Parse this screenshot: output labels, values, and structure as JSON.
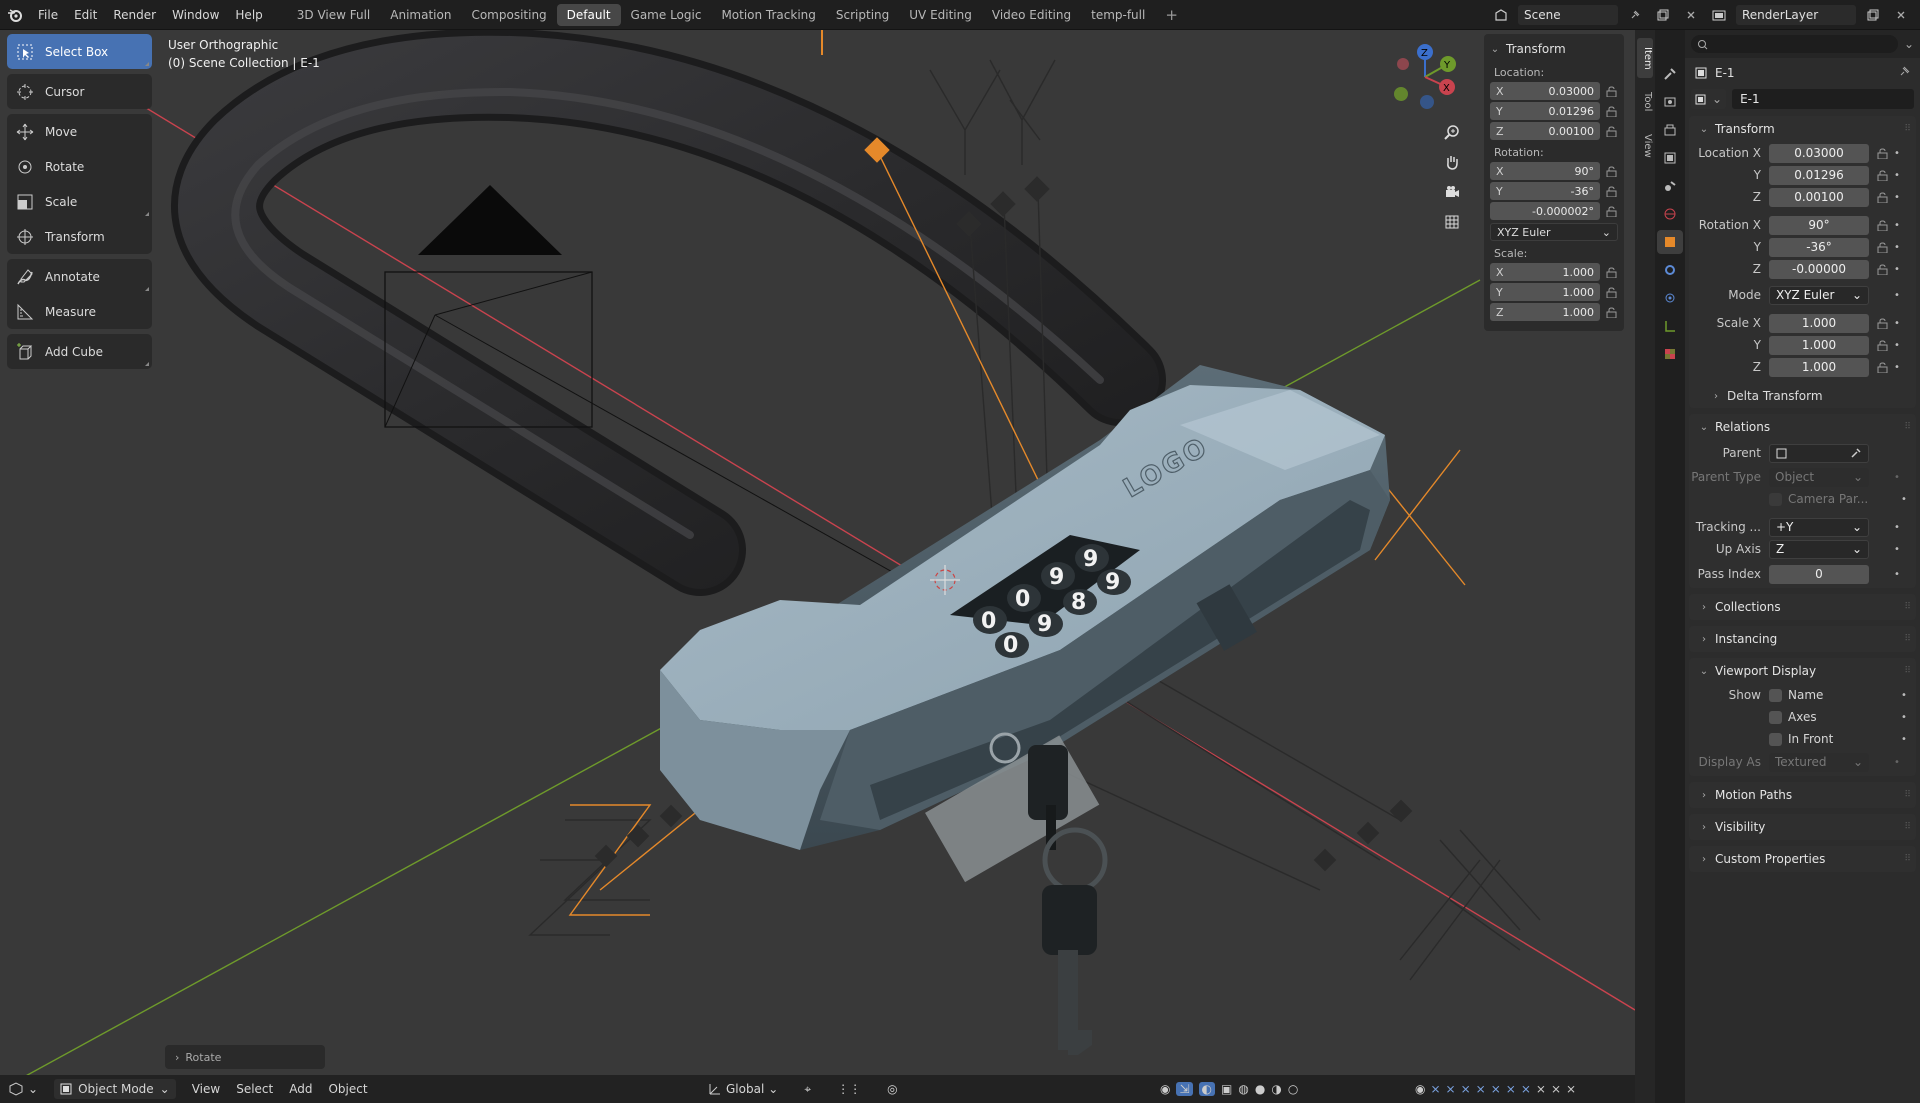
{
  "topbar": {
    "menus": [
      "File",
      "Edit",
      "Render",
      "Window",
      "Help"
    ],
    "workspaces": [
      "3D View Full",
      "Animation",
      "Compositing",
      "Default",
      "Game Logic",
      "Motion Tracking",
      "Scripting",
      "UV Editing",
      "Video Editing",
      "temp-full"
    ],
    "active_workspace": "Default",
    "plus": "+",
    "scene": "Scene",
    "render_layer": "RenderLayer"
  },
  "toolbar": {
    "tools": [
      {
        "label": "Select Box",
        "icon": "select-box-icon",
        "active": true
      },
      {
        "label": "Cursor",
        "icon": "cursor-icon"
      },
      {
        "label": "Move",
        "icon": "move-icon"
      },
      {
        "label": "Rotate",
        "icon": "rotate-icon"
      },
      {
        "label": "Scale",
        "icon": "scale-icon"
      },
      {
        "label": "Transform",
        "icon": "transform-icon"
      },
      {
        "label": "Annotate",
        "icon": "annotate-icon"
      },
      {
        "label": "Measure",
        "icon": "measure-icon"
      },
      {
        "label": "Add Cube",
        "icon": "add-cube-icon"
      }
    ]
  },
  "viewport": {
    "view_name": "User Orthographic",
    "collection": "(0) Scene Collection | E-1",
    "lock_logo": "LOGO",
    "dial_digits": [
      "0",
      "0",
      "9",
      "9",
      "0",
      "9",
      "8",
      "9"
    ],
    "redo_panel": "Rotate",
    "gizmo": {
      "x": "X",
      "y": "Y",
      "z": "Z"
    },
    "tabs": [
      "Item",
      "Tool",
      "View"
    ]
  },
  "npanel": {
    "title": "Transform",
    "location_label": "Location:",
    "location": [
      {
        "axis": "X",
        "value": "0.03000"
      },
      {
        "axis": "Y",
        "value": "0.01296"
      },
      {
        "axis": "Z",
        "value": "0.00100"
      }
    ],
    "rotation_label": "Rotation:",
    "rotation": [
      {
        "axis": "X",
        "value": "90°"
      },
      {
        "axis": "Y",
        "value": "-36°"
      },
      {
        "axis": "",
        "value": "-0.000002°"
      }
    ],
    "rotation_mode": "XYZ Euler",
    "scale_label": "Scale:",
    "scale": [
      {
        "axis": "X",
        "value": "1.000"
      },
      {
        "axis": "Y",
        "value": "1.000"
      },
      {
        "axis": "Z",
        "value": "1.000"
      }
    ]
  },
  "header": {
    "mode": "Object Mode",
    "menus": [
      "View",
      "Select",
      "Add",
      "Object"
    ],
    "orientation": "Global"
  },
  "properties": {
    "object_name": "E-1",
    "transform": {
      "title": "Transform",
      "location_x_label": "Location X",
      "location_x": "0.03000",
      "y_label": "Y",
      "location_y": "0.01296",
      "z_label": "Z",
      "location_z": "0.00100",
      "rotation_x_label": "Rotation X",
      "rotation_x": "90°",
      "rotation_y": "-36°",
      "rotation_z": "-0.00000",
      "mode_label": "Mode",
      "mode": "XYZ Euler",
      "scale_x_label": "Scale X",
      "scale_x": "1.000",
      "scale_y": "1.000",
      "scale_z": "1.000",
      "delta": "Delta Transform"
    },
    "relations": {
      "title": "Relations",
      "parent_label": "Parent",
      "parent_type_label": "Parent Type",
      "parent_type": "Object",
      "camera_parent": "Camera Par...",
      "tracking_label": "Tracking ...",
      "tracking": "+Y",
      "up_axis_label": "Up Axis",
      "up_axis": "Z",
      "pass_index_label": "Pass Index",
      "pass_index": "0"
    },
    "collections": "Collections",
    "instancing": "Instancing",
    "viewport_display": {
      "title": "Viewport Display",
      "show_label": "Show",
      "name": "Name",
      "axes": "Axes",
      "in_front": "In Front",
      "display_as_label": "Display As",
      "display_as": "Textured"
    },
    "motion_paths": "Motion Paths",
    "visibility": "Visibility",
    "custom_properties": "Custom Properties"
  },
  "colors": {
    "accent": "#4772b3",
    "viewport_bg": "#393939",
    "orange": "#e5892a",
    "x_axis": "#c9434e",
    "y_axis": "#6e9a2b"
  }
}
